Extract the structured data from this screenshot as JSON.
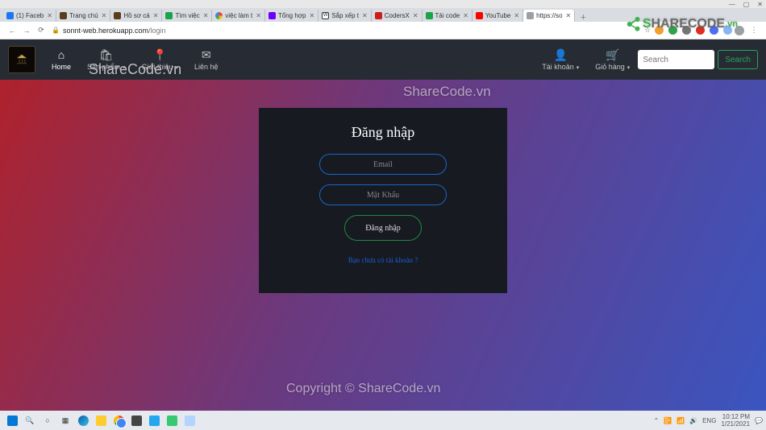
{
  "browser": {
    "window_controls": {
      "min": "—",
      "max": "▢",
      "close": "✕"
    },
    "tabs": [
      {
        "fav": "#1877f2",
        "label": "(1) Faceb",
        "active": false
      },
      {
        "fav": "#5a3d1a",
        "label": "Trang chú",
        "active": false
      },
      {
        "fav": "#5a3d1a",
        "label": "Hồ sơ cá",
        "active": false
      },
      {
        "fav": "#1aa34a",
        "label": "Tìm việc",
        "active": false
      },
      {
        "fav": "#ffffff",
        "label": "việc làm t",
        "active": false,
        "g": true
      },
      {
        "fav": "#6a00ff",
        "label": "Tổng hợp",
        "active": false
      },
      {
        "fav": "#777777",
        "label": "Sắp xếp t",
        "active": false,
        "w": true
      },
      {
        "fav": "#cc1d1d",
        "label": "CodersX",
        "active": false
      },
      {
        "fav": "#1aa34a",
        "label": "Tải code",
        "active": false
      },
      {
        "fav": "#ff0000",
        "label": "YouTube",
        "active": false
      },
      {
        "fav": "#9ba0a6",
        "label": "https://so",
        "active": true
      }
    ],
    "nav_back": "←",
    "nav_fwd": "→",
    "nav_reload": "⟳",
    "url_host": "sonnt-web.herokuapp.com",
    "url_path": "/login",
    "star": "☆",
    "menu": "⋮"
  },
  "nav": {
    "items": [
      {
        "icon": "⌂",
        "label": "Home",
        "active": true,
        "drop": false
      },
      {
        "icon": "🛍",
        "label": "Sản phẩm",
        "active": false,
        "drop": true
      },
      {
        "icon": "📍",
        "label": "Giới thiệu",
        "active": false,
        "drop": true
      },
      {
        "icon": "✉",
        "label": "Liên hệ",
        "active": false,
        "drop": false
      }
    ],
    "account": {
      "icon": "👤",
      "label": "Tài khoản"
    },
    "cart": {
      "icon": "🛒",
      "label": "Giỏ hàng"
    },
    "search_placeholder": "Search",
    "search_btn": "Search"
  },
  "login": {
    "title": "Đăng nhập",
    "email_ph": "Email",
    "pass_ph": "Mật Khẩu",
    "submit": "Đăng nhập",
    "signup": "Bạn chưa có tài khoản ?"
  },
  "watermark": {
    "brand_s": "S",
    "brand_rest": "HARECODE",
    "brand_vn": ".vn",
    "t1": "ShareCode.vn",
    "t2": "ShareCode.vn",
    "t3": "Copyright © ShareCode.vn"
  },
  "taskbar": {
    "time": "10:12 PM",
    "date": "1/21/2021",
    "lang": "ENG",
    "tray": [
      "⌃",
      "📴",
      "🖥",
      "📶",
      "🔊"
    ]
  }
}
